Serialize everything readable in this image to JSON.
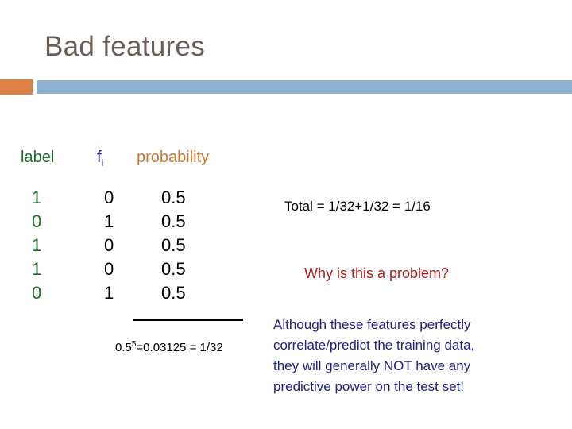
{
  "slide": {
    "title": "Bad features",
    "accent_bar_orange_color": "#dd8144",
    "accent_bar_blue_color": "#8fb2d0",
    "title_color": "#6b5d56",
    "background_color": "#ffffff"
  },
  "table": {
    "headers": {
      "label": "label",
      "feature_base": "f",
      "feature_subscript": "i",
      "probability": "probability"
    },
    "header_colors": {
      "label": "#1a6b2a",
      "feature": "#1a1a8c",
      "probability": "#d2762e"
    },
    "rows": [
      {
        "label": "1",
        "feature": "0",
        "probability": "0.5"
      },
      {
        "label": "0",
        "feature": "1",
        "probability": "0.5"
      },
      {
        "label": "1",
        "feature": "0",
        "probability": "0.5"
      },
      {
        "label": "1",
        "feature": "0",
        "probability": "0.5"
      },
      {
        "label": "0",
        "feature": "1",
        "probability": "0.5"
      }
    ],
    "product": {
      "base": "0.5",
      "exponent": "5",
      "result": "=0.03125 = 1/32",
      "full_text": "0.55=0.03125 = 1/32"
    }
  },
  "annotations": {
    "total": "Total = 1/32+1/32 = 1/16",
    "question": "Why is this a problem?",
    "question_color": "#b01c1c",
    "explanation_color": "#202087",
    "explanation_lines": [
      "Although these features perfectly",
      "correlate/predict the training data,",
      "they will generally NOT have any",
      "predictive power on the test set!"
    ]
  }
}
